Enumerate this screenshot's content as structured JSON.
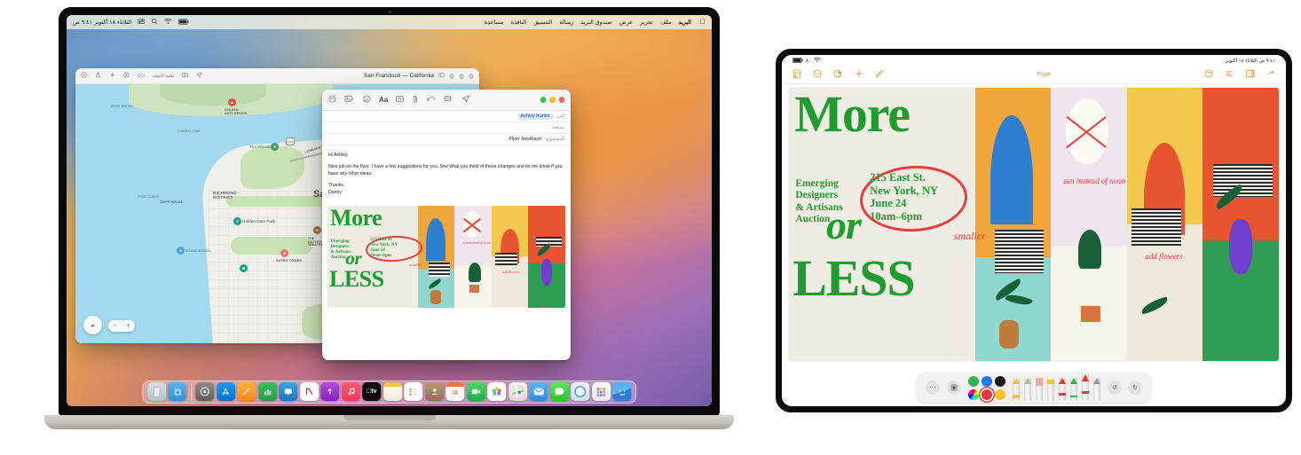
{
  "macbook": {
    "menubar": {
      "apple_icon": "apple-icon",
      "menus": [
        "البريد",
        "ملف",
        "تحرير",
        "عرض",
        "صندوق البريد",
        "رسالة",
        "التنسيق",
        "النافذة",
        "مساعدة"
      ],
      "status_icons": [
        "control-center-icon",
        "search-icon",
        "wifi-icon",
        "battery-icon"
      ],
      "clock": "الثلاثاء ١٨ أكتوبر ٩:٤١ ص"
    },
    "maps": {
      "title": "San Francisco — California",
      "toolbar_icons": [
        "info-icon",
        "share-icon",
        "add-icon",
        "location-icon",
        "binoculars-icon",
        "map-book-icon",
        "directions-icon"
      ],
      "toolbar_label": "تقلية الاتجاه",
      "window_controls": [
        "close",
        "minimize",
        "zoom"
      ],
      "labels": [
        "Point Bonita",
        "Golden Gate",
        "Point Lobos",
        "RICHMOND DISTRICT",
        "Golden Gate Park",
        "Ocean Beach",
        "The Presidio",
        "CLIFF HOUSE",
        "SUTRO TOWER",
        "GOLDEN GATE BRIDGE",
        "LOMBARD ST",
        "THE CASTRO THEATRE",
        "Sa"
      ],
      "highway": "101",
      "compass_label": "ش",
      "zoom_out": "−",
      "zoom_in": "+"
    },
    "mail": {
      "toolbar_icons": [
        "archive-icon",
        "photo-browser-icon",
        "emoji-icon",
        "format-icon",
        "markup-icon",
        "attach-icon",
        "reply-icon",
        "stationery-icon",
        "send-icon"
      ],
      "window_controls": [
        "close",
        "minimize",
        "zoom"
      ],
      "to_label": "إلى:",
      "to_value": "Ashley Kamin",
      "cc_label": "نسخة:",
      "cc_value": "",
      "subject_label": "الموضوع:",
      "subject_value": "Flyer feedback",
      "body": [
        "Hi Ashley,",
        "Nice job on the flyer. I have a few suggestions for you. See what you think of these changes and let me know if you have any other ideas.",
        "Thanks,",
        "Danny"
      ]
    },
    "dock": {
      "items": [
        "finder-icon",
        "launchpad-icon",
        "safari-icon",
        "messages-icon",
        "photos-icon",
        "mail-icon",
        "maps-icon",
        "pages-icon",
        "contacts-icon",
        "facetime-icon",
        "reminders-icon",
        "notes-icon",
        "apple-tv-icon",
        "music-icon",
        "podcasts-icon",
        "news-icon",
        "keynote-icon",
        "numbers-icon",
        "freeform-icon",
        "app-store-icon",
        "system-settings-icon",
        "trash-icon",
        "downloads-icon"
      ]
    }
  },
  "ipad": {
    "status": {
      "battery_icon": "battery-icon",
      "charge": "٨٠",
      "wifi_icon": "wifi-icon",
      "clock": "٩:٤١ ص  الثلاثاء ١٨ أكتوبر"
    },
    "toolbar": {
      "left_icons": [
        "documents-icon",
        "zoom-out-icon",
        "collaborate-icon",
        "insert-icon",
        "markup-pen-icon"
      ],
      "title": "Flyer",
      "right_icons": [
        "help-icon",
        "format-icon",
        "sidebar-icon",
        "more-icon"
      ]
    },
    "markup": {
      "more_icon": "more-icon",
      "shapes_icon": "shapes-icon",
      "swatches": [
        "#32b551",
        "#1b7ae8",
        "#1b1b1b",
        "color-wheel",
        "#e23b3b",
        "#f4c430"
      ],
      "selected_swatch": "#e23b3b",
      "tools": [
        "highlighter-pen",
        "pencil-tool",
        "eraser-tool",
        "glue-tool",
        "marker-red",
        "marker-green",
        "pen-red",
        "fine-pen"
      ],
      "undo_icon": "undo-icon",
      "redo_icon": "redo-icon"
    }
  },
  "flyer": {
    "title_more": "More",
    "title_or": "or",
    "title_less": "LESS",
    "info_lines": [
      "Emerging",
      "Designers",
      "& Artisans",
      "Auction"
    ],
    "address_lines": [
      "215 East St.",
      "New York, NY",
      "June 24",
      "10am–6pm"
    ],
    "annotations": [
      "smaller",
      "sun instead of noon",
      "add flowers"
    ],
    "accent_green": "#1f9c2e",
    "annotation_red": "#ef3b3b",
    "paper": "#efece4"
  }
}
